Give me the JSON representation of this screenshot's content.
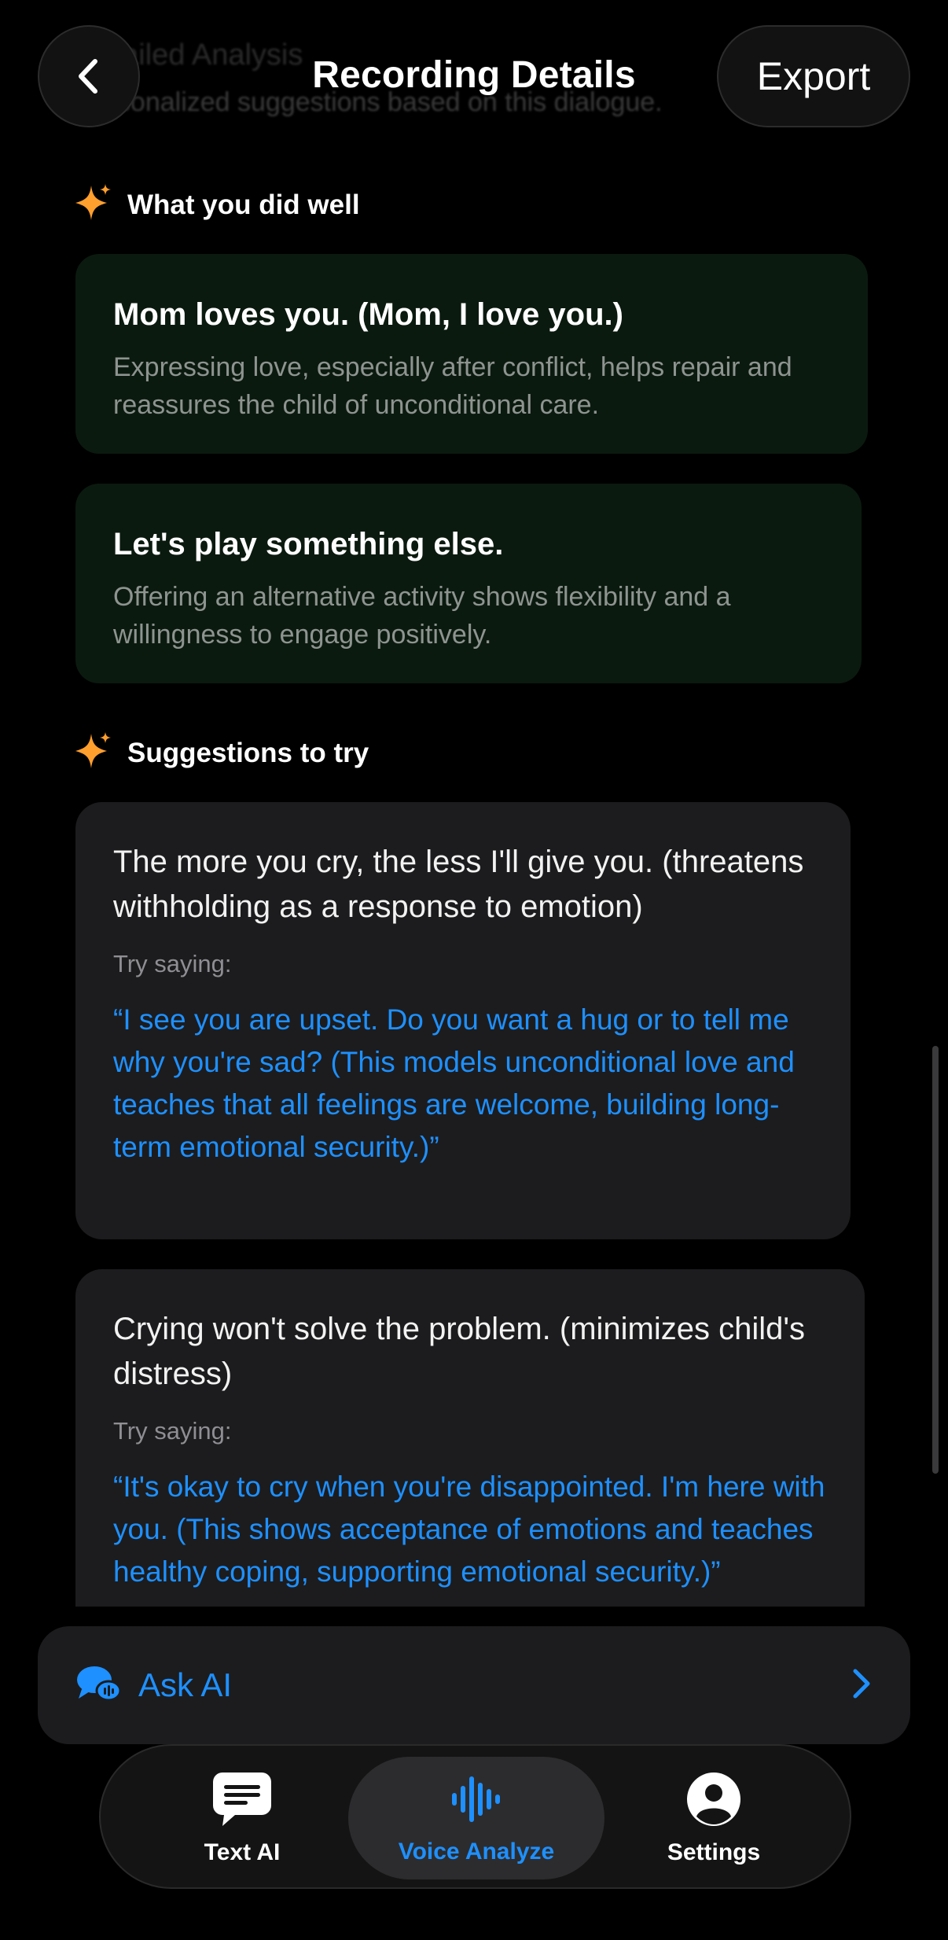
{
  "header": {
    "ghost_title": "Detailed Analysis",
    "ghost_subtitle": "Personalized suggestions based on this dialogue.",
    "title": "Recording Details",
    "export_label": "Export"
  },
  "did_well": {
    "heading": "What you did well",
    "items": [
      {
        "title": "Mom loves you. (Mom, I love you.)",
        "desc": "Expressing love, especially after conflict, helps repair and reassures the child of unconditional care."
      },
      {
        "title": "Let's play something else.",
        "desc": "Offering an alternative activity shows flexibility and a willingness to engage positively."
      }
    ]
  },
  "suggestions": {
    "heading": "Suggestions to try",
    "items": [
      {
        "quote": "The more you cry, the less I'll give you. (threatens withholding as a response to emotion)",
        "try_label": "Try saying:",
        "try_text": "“I see you are upset. Do you want a hug or to tell me why you're sad? (This models unconditional love and teaches that all feelings are welcome, building long-term emotional security.)”"
      },
      {
        "quote": "Crying won't solve the problem. (minimizes child's distress)",
        "try_label": "Try saying:",
        "try_text": "“It's okay to cry when you're disappointed. I'm here with you. (This shows acceptance of emotions and teaches healthy coping, supporting emotional security.)”"
      }
    ]
  },
  "ask_ai": {
    "label": "Ask AI"
  },
  "tabs": [
    {
      "label": "Text AI",
      "icon": "chat-bubble-icon",
      "active": false
    },
    {
      "label": "Voice Analyze",
      "icon": "waveform-icon",
      "active": true
    },
    {
      "label": "Settings",
      "icon": "person-circle-icon",
      "active": false
    }
  ],
  "colors": {
    "accent": "#1e90ff",
    "sparkle": "#ff9f2e",
    "good_card_bg": "#0b1a0f",
    "card_bg": "#1c1c1e"
  }
}
